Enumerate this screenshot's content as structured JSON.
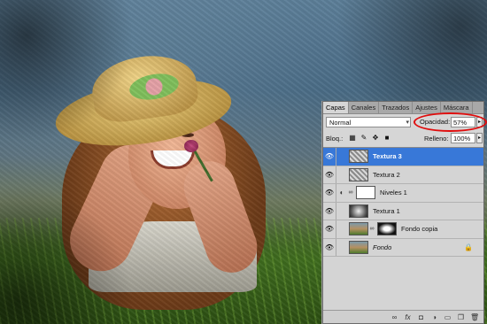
{
  "panel": {
    "tabs": [
      {
        "label": "Capas",
        "active": true
      },
      {
        "label": "Canales",
        "active": false
      },
      {
        "label": "Trazados",
        "active": false
      },
      {
        "label": "Ajustes",
        "active": false
      },
      {
        "label": "Máscara",
        "active": false
      }
    ],
    "blend_mode": "Normal",
    "opacity_label": "Opacidad:",
    "opacity_value": "57%",
    "lock_label": "Bloq.:",
    "fill_label": "Relleno:",
    "fill_value": "100%",
    "highlight_color": "#e00d0d",
    "selected_color": "#3878d8",
    "layers": [
      {
        "name": "Textura 3",
        "selected": true,
        "thumb": "texture"
      },
      {
        "name": "Textura 2",
        "selected": false,
        "thumb": "texture"
      },
      {
        "name": "Niveles 1",
        "selected": false,
        "thumb": "adjustment-with-mask"
      },
      {
        "name": "Textura 1",
        "selected": false,
        "thumb": "texture-dark"
      },
      {
        "name": "Fondo copia",
        "selected": false,
        "thumb": "photo-with-mask"
      },
      {
        "name": "Fondo",
        "selected": false,
        "thumb": "photo",
        "locked": true
      }
    ],
    "footer_icons": [
      "link-icon",
      "fx-icon",
      "add-mask-icon",
      "adjustment-icon",
      "group-icon",
      "new-layer-icon",
      "trash-icon"
    ]
  }
}
